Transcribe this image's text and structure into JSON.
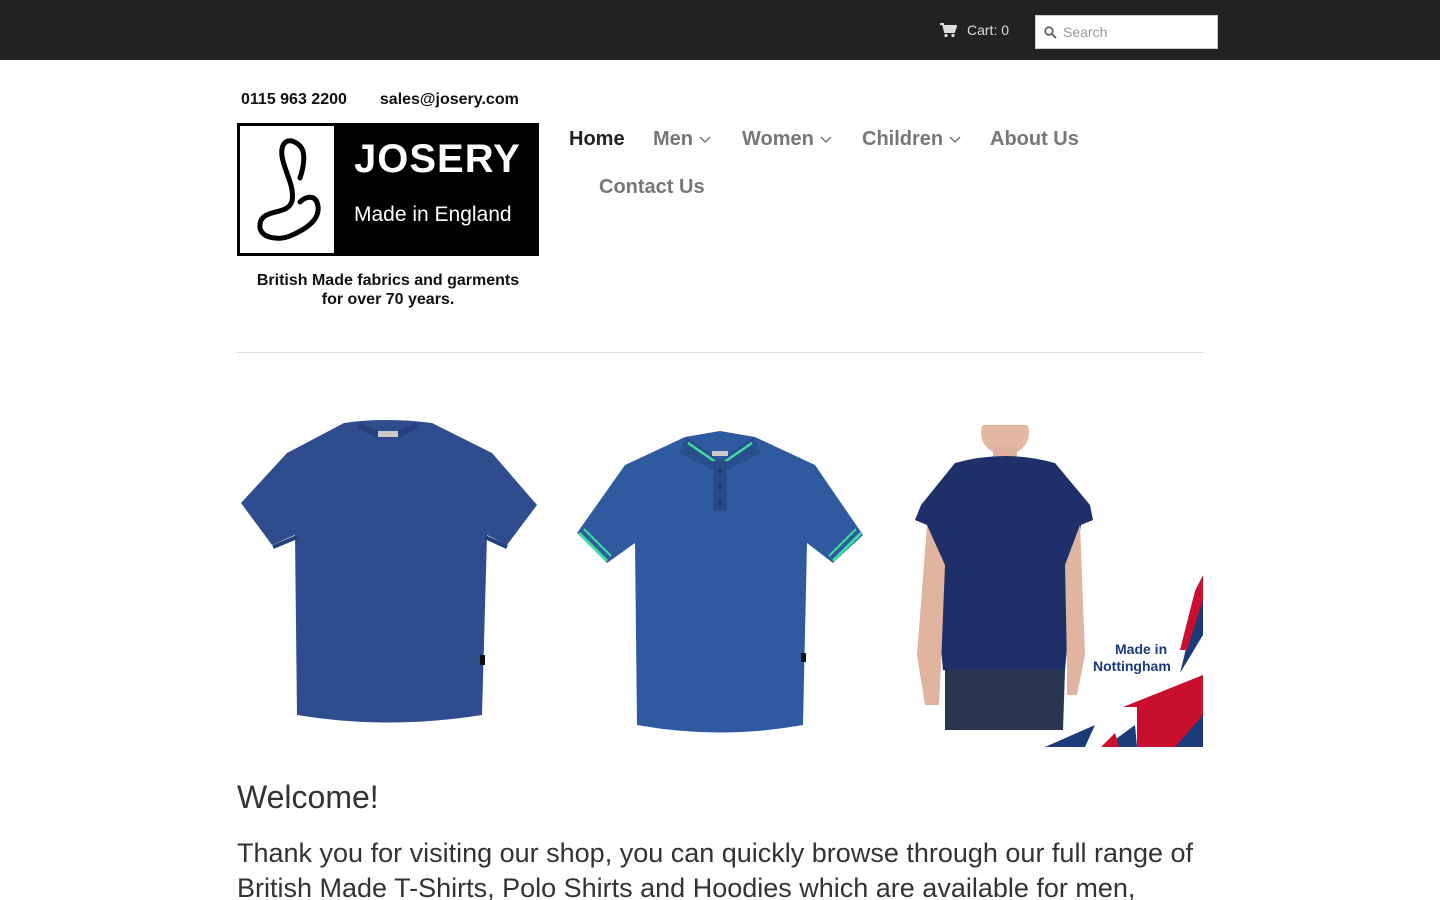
{
  "topbar": {
    "cart_label": "Cart: 0",
    "search_placeholder": "Search"
  },
  "header": {
    "phone": "0115 963 2200",
    "email": "sales@josery.com",
    "logo_name": "JOSERY",
    "logo_subtitle": "Made in England",
    "tagline_line1": "British Made fabrics and garments",
    "tagline_line2": "for over 70 years."
  },
  "nav": {
    "items": [
      {
        "label": "Home",
        "active": true
      },
      {
        "label": "Men",
        "dropdown": true
      },
      {
        "label": "Women",
        "dropdown": true
      },
      {
        "label": "Children",
        "dropdown": true
      },
      {
        "label": "About Us"
      },
      {
        "label": "Contact Us"
      }
    ]
  },
  "banner": {
    "badge_line1": "Made  in",
    "badge_line2": "Nottingham"
  },
  "content": {
    "heading": "Welcome!",
    "intro": "Thank you for visiting our shop, you can quickly browse through our full range of British Made T-Shirts, Polo Shirts and Hoodies which are available for men,"
  },
  "colors": {
    "topbar": "#222222",
    "nav_active": "#222222",
    "nav_inactive": "#777777",
    "garment_blue": "#2f4d8e",
    "polo_trim": "#3ddc9a",
    "flag_red": "#c8102e",
    "flag_blue": "#1a3a7a"
  }
}
